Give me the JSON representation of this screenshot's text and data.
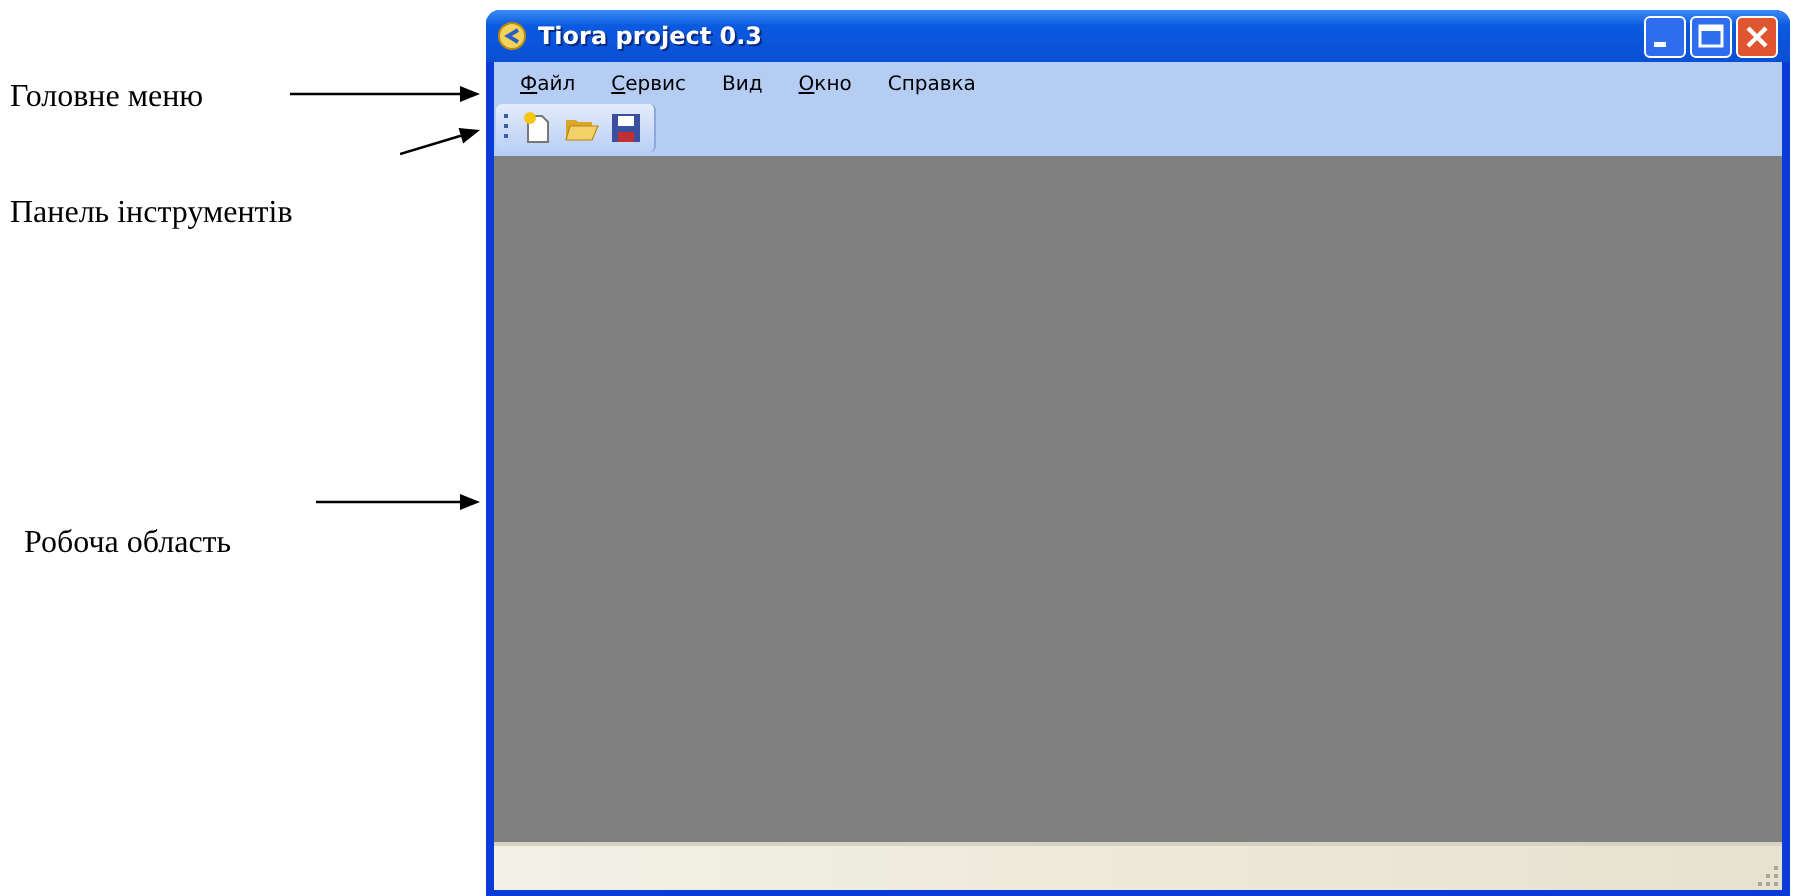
{
  "annotations": [
    {
      "text": "Головне меню"
    },
    {
      "text": "Панель інструментів"
    },
    {
      "text": "Робоча область"
    }
  ],
  "window": {
    "title": "Tiora project 0.3",
    "controls": [
      {
        "kind": "minimize"
      },
      {
        "kind": "maximize"
      },
      {
        "kind": "close"
      }
    ],
    "menu": [
      {
        "label": "Файл",
        "mnemonic": true
      },
      {
        "label": "Сервис",
        "mnemonic": true
      },
      {
        "label": "Вид",
        "mnemonic": false
      },
      {
        "label": "Окно",
        "mnemonic": true
      },
      {
        "label": "Справка",
        "mnemonic": false
      }
    ],
    "toolbar": [
      {
        "kind": "new"
      },
      {
        "kind": "open"
      },
      {
        "kind": "save"
      }
    ]
  }
}
